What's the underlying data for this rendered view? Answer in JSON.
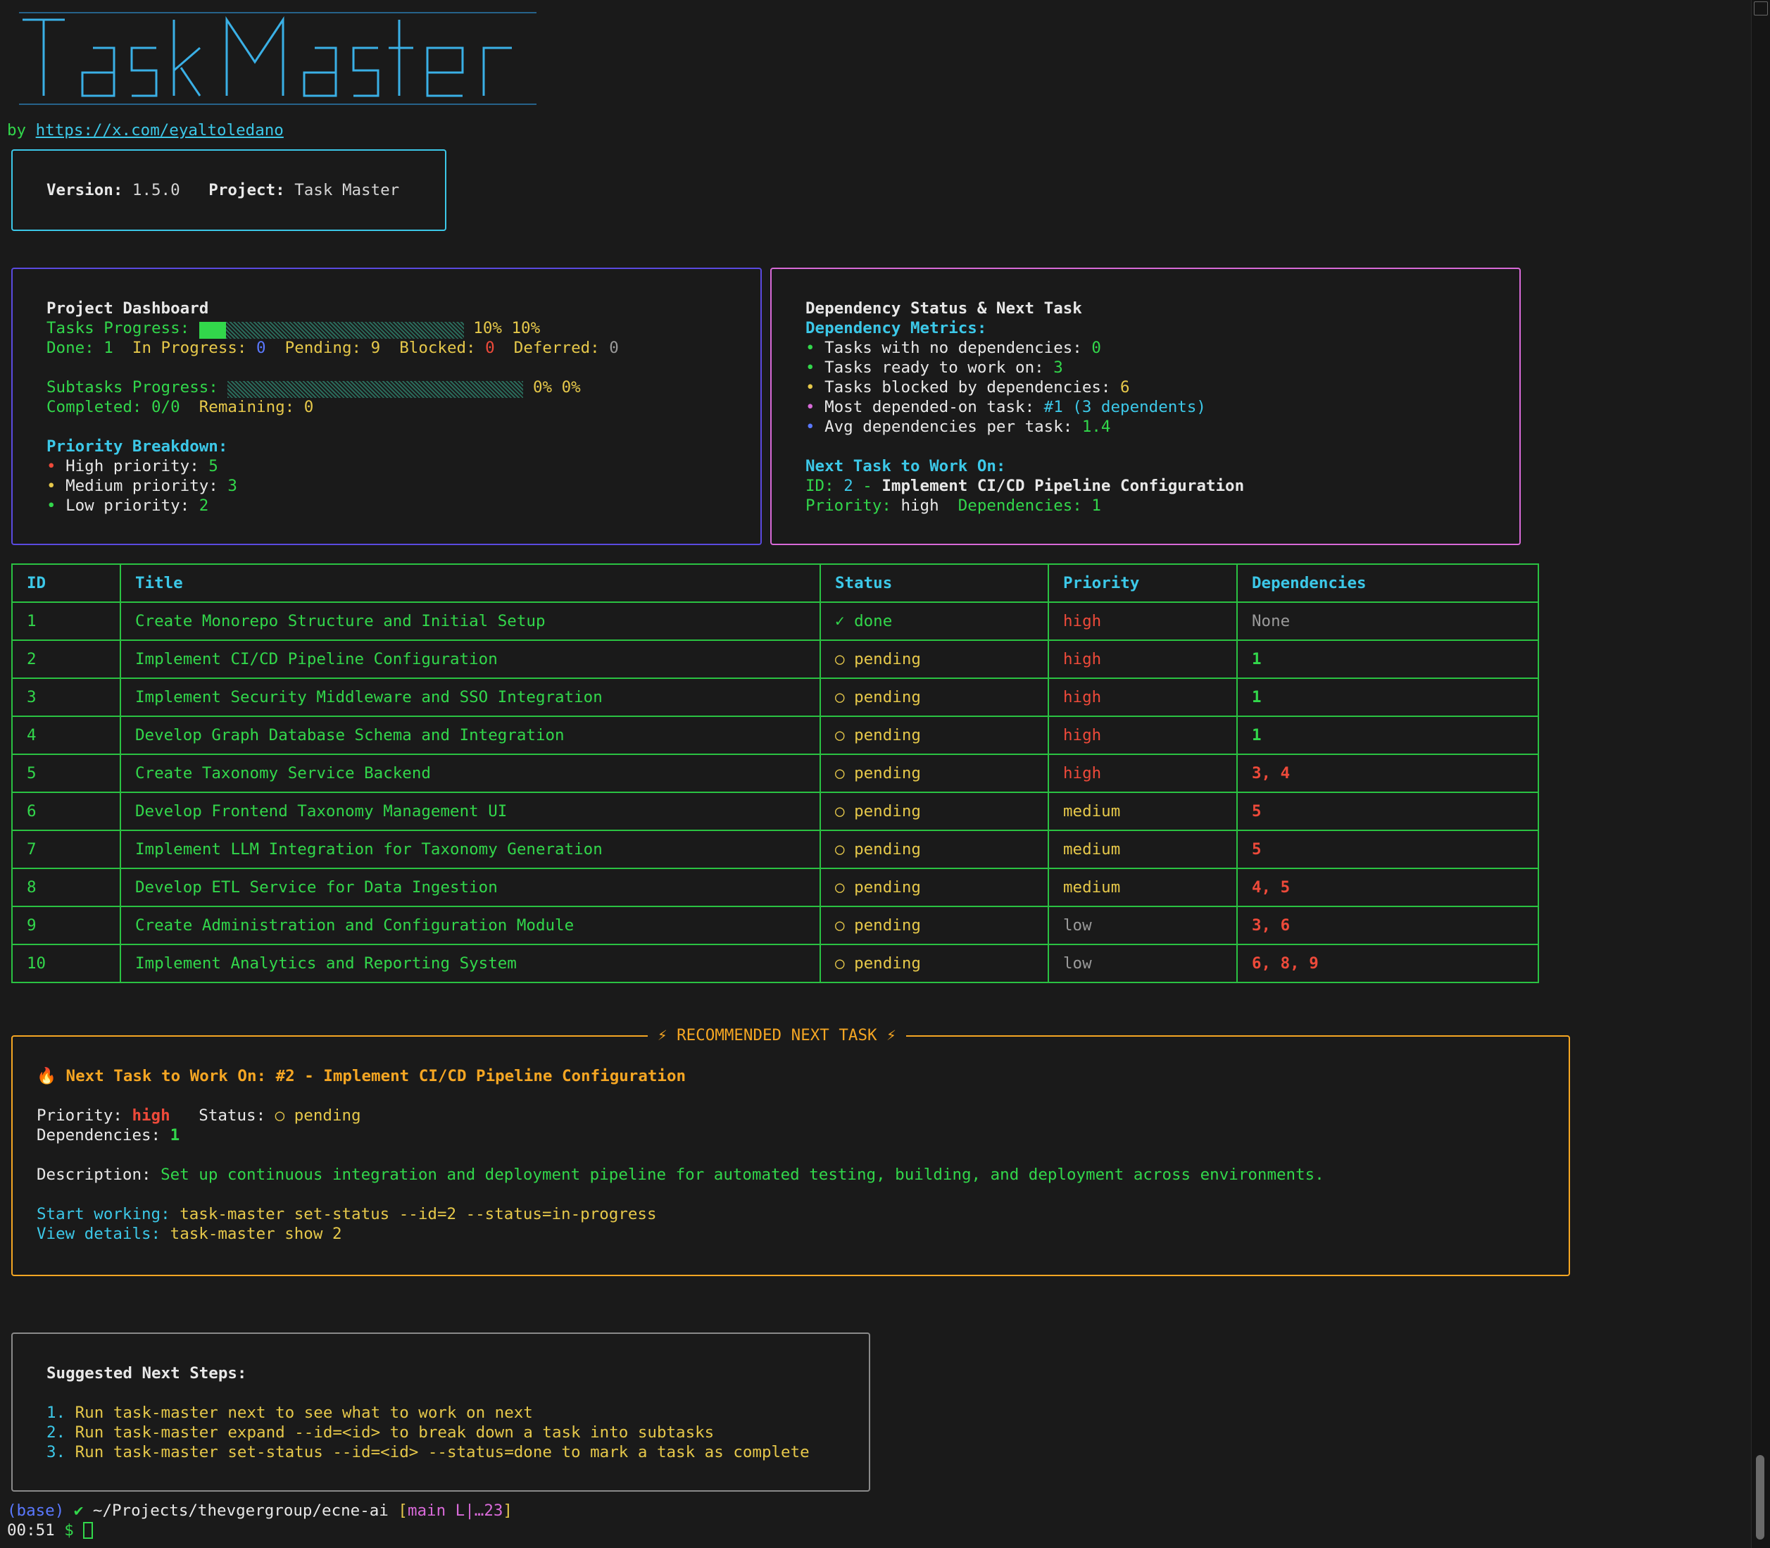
{
  "app": {
    "name": "Task Master",
    "byline_prefix": "by ",
    "byline_url": "https://x.com/eyaltoledano"
  },
  "info": {
    "version_label": "Version:",
    "version": "1.5.0",
    "project_label": "Project:",
    "project": "Task Master"
  },
  "dashboard": {
    "title": "Project Dashboard",
    "tasks_progress_label": "Tasks Progress:",
    "tasks_progress_fraction": 0.1,
    "tasks_progress_text": "10% 10%",
    "done_label": "Done:",
    "done": "1",
    "in_progress_label": "In Progress:",
    "in_progress": "0",
    "pending_label": "Pending:",
    "pending": "9",
    "blocked_label": "Blocked:",
    "blocked": "0",
    "deferred_label": "Deferred:",
    "deferred": "0",
    "subtasks_progress_label": "Subtasks Progress:",
    "subtasks_progress_fraction": 0.0,
    "subtasks_progress_text": "0% 0%",
    "completed_label": "Completed:",
    "completed": "0/0",
    "remaining_label": "Remaining:",
    "remaining": "0",
    "priority_title": "Priority Breakdown:",
    "high_label": "High priority:",
    "high": "5",
    "medium_label": "Medium priority:",
    "medium": "3",
    "low_label": "Low priority:",
    "low": "2"
  },
  "dependency": {
    "title": "Dependency Status & Next Task",
    "metrics_title": "Dependency Metrics:",
    "no_deps_label": "Tasks with no dependencies:",
    "no_deps": "0",
    "ready_label": "Tasks ready to work on:",
    "ready": "3",
    "blocked_label": "Tasks blocked by dependencies:",
    "blocked": "6",
    "most_label": "Most depended-on task:",
    "most": "#1 (3 dependents)",
    "avg_label": "Avg dependencies per task:",
    "avg": "1.4",
    "next_title": "Next Task to Work On:",
    "next_id_label": "ID:",
    "next_id": "2",
    "next_sep": "-",
    "next_name": "Implement CI/CD Pipeline Configuration",
    "next_priority_label": "Priority:",
    "next_priority": "high",
    "next_deps_label": "Dependencies:",
    "next_deps": "1"
  },
  "table": {
    "headers": [
      "ID",
      "Title",
      "Status",
      "Priority",
      "Dependencies"
    ],
    "rows": [
      {
        "id": "1",
        "title": "Create Monorepo Structure and Initial Setup",
        "status": "✓ done",
        "priority": "high",
        "deps": "None"
      },
      {
        "id": "2",
        "title": "Implement CI/CD Pipeline Configuration",
        "status": "○ pending",
        "priority": "high",
        "deps": "1"
      },
      {
        "id": "3",
        "title": "Implement Security Middleware and SSO Integration",
        "status": "○ pending",
        "priority": "high",
        "deps": "1"
      },
      {
        "id": "4",
        "title": "Develop Graph Database Schema and Integration",
        "status": "○ pending",
        "priority": "high",
        "deps": "1"
      },
      {
        "id": "5",
        "title": "Create Taxonomy Service Backend",
        "status": "○ pending",
        "priority": "high",
        "deps": "3, 4"
      },
      {
        "id": "6",
        "title": "Develop Frontend Taxonomy Management UI",
        "status": "○ pending",
        "priority": "medium",
        "deps": "5"
      },
      {
        "id": "7",
        "title": "Implement LLM Integration for Taxonomy Generation",
        "status": "○ pending",
        "priority": "medium",
        "deps": "5"
      },
      {
        "id": "8",
        "title": "Develop ETL Service for Data Ingestion",
        "status": "○ pending",
        "priority": "medium",
        "deps": "4, 5"
      },
      {
        "id": "9",
        "title": "Create Administration and Configuration Module",
        "status": "○ pending",
        "priority": "low",
        "deps": "3, 6"
      },
      {
        "id": "10",
        "title": "Implement Analytics and Reporting System",
        "status": "○ pending",
        "priority": "low",
        "deps": "6, 8, 9"
      }
    ]
  },
  "recommended": {
    "legend": "⚡ RECOMMENDED NEXT TASK ⚡",
    "heading": "🔥 Next Task to Work On: #2 - Implement CI/CD Pipeline Configuration",
    "priority_label": "Priority:",
    "priority": "high",
    "status_label": "Status:",
    "status": "○ pending",
    "deps_label": "Dependencies:",
    "deps": "1",
    "desc_label": "Description:",
    "description": "Set up continuous integration and deployment pipeline for automated testing, building, and deployment across environments.",
    "start_label": "Start working:",
    "start_cmd": "task-master set-status --id=2 --status=in-progress",
    "view_label": "View details:",
    "view_cmd": "task-master show 2"
  },
  "suggested": {
    "title": "Suggested Next Steps:",
    "steps": [
      {
        "num": "1.",
        "text": "Run task-master next to see what to work on next"
      },
      {
        "num": "2.",
        "text": "Run task-master expand --id=<id> to break down a task into subtasks"
      },
      {
        "num": "3.",
        "text": "Run task-master set-status --id=<id> --status=done to mark a task as complete"
      }
    ]
  },
  "prompt": {
    "env": "(base)",
    "check": "✔",
    "path": "~/Projects/thevgergroup/ecne-ai",
    "branch_open": "[",
    "branch": "main L|…23",
    "branch_close": "]",
    "time": "00:51",
    "symbol": "$"
  },
  "colors": {
    "green": "#32d74b",
    "cyan": "#3cc8e8",
    "yellow": "#e6c84a",
    "red": "#ee4a3a",
    "orange": "#f5a623",
    "magenta": "#d86ad8",
    "blue": "#5a78ff"
  }
}
